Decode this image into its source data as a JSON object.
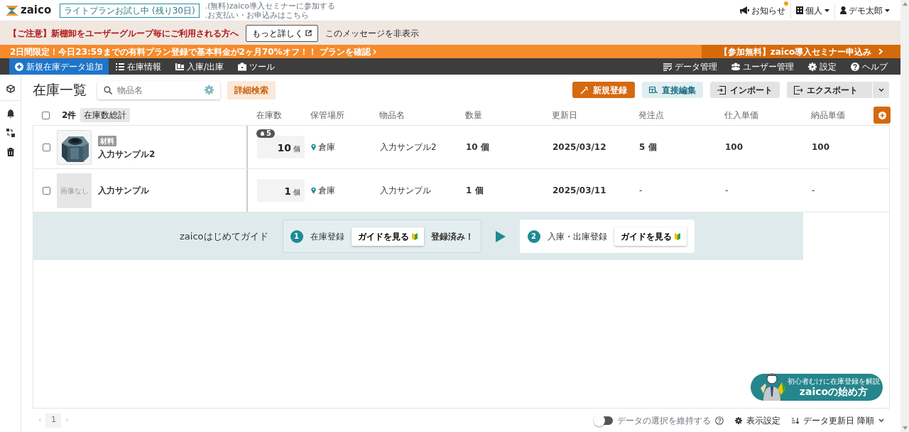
{
  "header": {
    "logo": "zaico",
    "trial_badge": "ライトプランお試し中 (残り30日)",
    "links": [
      ".(無料)zaico導入セミナーに参加する",
      ".お支払い・お申込みはこちら"
    ],
    "notifications": {
      "label": "お知らせ",
      "unread": true
    },
    "workspace": "個人",
    "user": "デモ太郎"
  },
  "notice": {
    "text": "【ご注意】新棚卸をユーザーグループ毎にご利用される方へ",
    "button": "もっと詳しく",
    "dismiss": "このメッセージを非表示"
  },
  "promo": {
    "text": "2日間限定！今日23:59までの有料プラン登録で基本料金が2ヶ月70%オフ！！",
    "link": "プランを確認",
    "seminar": "【参加無料】zaico導入セミナー申込み"
  },
  "nav": {
    "left": [
      {
        "label": "新規在庫データ追加",
        "selected": true
      },
      {
        "label": "在庫情報",
        "selected": false
      },
      {
        "label": "入庫/出庫",
        "selected": false
      },
      {
        "label": "ツール",
        "selected": false
      }
    ],
    "right": [
      {
        "label": "データ管理"
      },
      {
        "label": "ユーザー管理"
      },
      {
        "label": "設定"
      },
      {
        "label": "ヘルプ"
      }
    ]
  },
  "page": {
    "title": "在庫一覧",
    "search": {
      "placeholder": "物品名"
    },
    "advanced_search": "詳細検索",
    "actions": [
      {
        "label": "新規登録",
        "kind": "primary"
      },
      {
        "label": "直接編集",
        "kind": "info"
      },
      {
        "label": "インポート",
        "kind": "plain"
      },
      {
        "label": "エクスポート",
        "kind": "split"
      }
    ]
  },
  "table": {
    "count": "2件",
    "total_button": "在庫数総計",
    "all_checked": false,
    "columns": [
      "在庫数",
      "保管場所",
      "物品名",
      "数量",
      "更新日",
      "発注点",
      "仕入単価",
      "納品単価"
    ],
    "rows": [
      {
        "checked": false,
        "kind": "picture",
        "tag": "材料",
        "name": "入力サンプル2",
        "alert": "5",
        "stock": "10",
        "unit": "個",
        "location": "倉庫",
        "item_name": "入力サンプル2",
        "quantity": "10 個",
        "updated": "2025/03/12",
        "reorder_point": "5 個",
        "purchase_price": "100",
        "sale_price": "100"
      },
      {
        "checked": false,
        "kind": "placeholder",
        "no_image": "画像なし",
        "name": "入力サンプル",
        "stock": "1",
        "unit": "個",
        "location": "倉庫",
        "item_name": "入力サンプル",
        "quantity": "1 個",
        "updated": "2025/03/11",
        "reorder_point": "-",
        "purchase_price": "-",
        "sale_price": "-"
      }
    ]
  },
  "guide": {
    "title": "zaicoはじめてガイド",
    "steps": [
      {
        "number": "1",
        "label": "在庫登録",
        "button": "ガイドを見る",
        "done": true,
        "status": "登録済み！"
      },
      {
        "number": "2",
        "label": "入庫・出庫登録",
        "button": "ガイドを見る",
        "done": false
      }
    ]
  },
  "promo_banner": {
    "subtitle": "初心者むけに在庫登録を解説",
    "title": "zaicoの始め方"
  },
  "footer": {
    "pagination": {
      "prev": "‹",
      "page": "1",
      "next": "›"
    },
    "keep_selection": {
      "label": "データの選択を維持する",
      "on": false
    },
    "display_settings": "表示設定",
    "sort": "データ更新日 降順"
  }
}
